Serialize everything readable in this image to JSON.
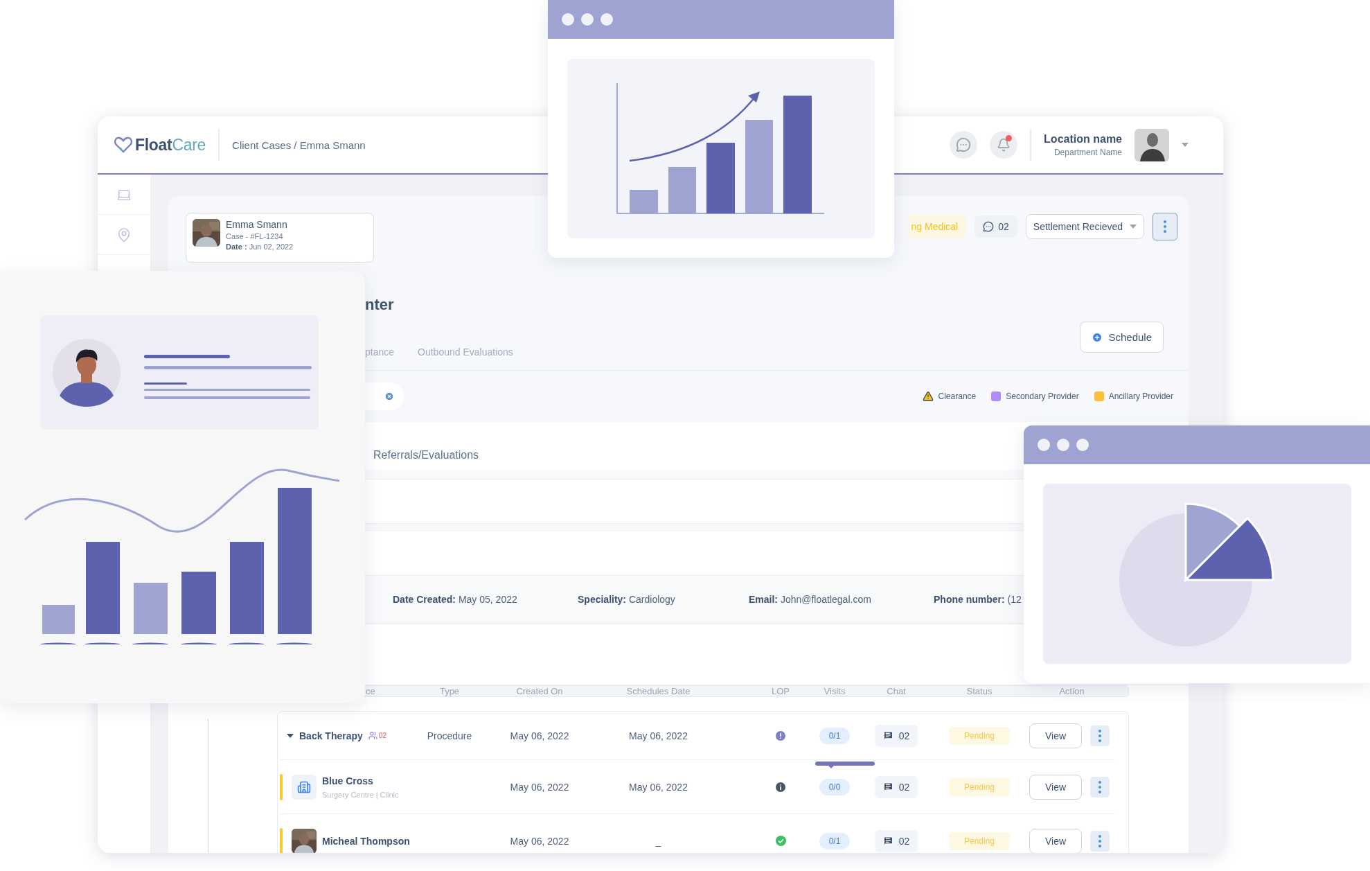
{
  "header": {
    "logo": {
      "primary": "Float",
      "accent": "Care"
    },
    "breadcrumb": "Client Cases / Emma Smann",
    "unread_alerts": true,
    "location": "Location name",
    "department": "Department Name"
  },
  "case_card": {
    "name": "Emma Smann",
    "case": "Case - #FL-1234",
    "date_label": "Date :",
    "date": "Jun 02, 2022"
  },
  "toolbar": {
    "badge": "ng Medical",
    "chat_count": "02",
    "status_select": "Settlement Recieved"
  },
  "heading": "nter",
  "tabs": [
    {
      "label": "ptance",
      "selected": false
    },
    {
      "label": "Outbound Evaluations",
      "selected": false
    }
  ],
  "schedule_button": "Schedule",
  "legend": [
    {
      "kind": "warning",
      "label": "Clearance"
    },
    {
      "kind": "swatch",
      "label": "Secondary Provider",
      "color": "#b18cf7"
    },
    {
      "kind": "swatch",
      "label": "Ancillary Provider",
      "color": "#fbbf3b"
    }
  ],
  "section_title": "Referrals/Evaluations",
  "details": [
    {
      "label": "Date Created:",
      "value": "May 05, 2022"
    },
    {
      "label": "Speciality:",
      "value": "Cardiology"
    },
    {
      "label": "Email:",
      "value": "John@floatlegal.com"
    },
    {
      "label": "Phone number:",
      "value": "(12"
    }
  ],
  "table": {
    "columns": [
      "ce",
      "Type",
      "Created On",
      "Schedules Date",
      "LOP",
      "Visits",
      "Chat",
      "Status",
      "Action"
    ],
    "rows": [
      {
        "kind": "procedure",
        "expanded": true,
        "name": "Back Therapy",
        "members": "02",
        "type": "Procedure",
        "created_on": "May 06, 2022",
        "schedules_date": "May 06, 2022",
        "lop": {
          "kind": "alert"
        },
        "visits": "0/1",
        "chat": "02",
        "status": "Pending",
        "action": "View"
      },
      {
        "kind": "provider",
        "avatar": {
          "kind": "building"
        },
        "color": "#f8c930",
        "name": "Blue Cross",
        "subtitle": "Surgery Centre | Clinic",
        "created_on": "May 06, 2022",
        "schedules_date": "May 06, 2022",
        "lop": {
          "kind": "info"
        },
        "visits": "0/0",
        "tooltip": true,
        "chat": "02",
        "status": "Pending",
        "action": "View"
      },
      {
        "kind": "provider",
        "color": "#f8c930",
        "name": "Micheal Thompson",
        "created_on": "May 06, 2022",
        "schedules_date": "_",
        "lop": {
          "kind": "approved"
        },
        "visits": "0/1",
        "tooltip": false,
        "chat": "02",
        "status": "Pending",
        "action": "View"
      }
    ]
  },
  "overlays": [
    {
      "kind": "bar_chart_window"
    },
    {
      "kind": "profile_card"
    },
    {
      "kind": "pie_chart_window"
    }
  ]
}
